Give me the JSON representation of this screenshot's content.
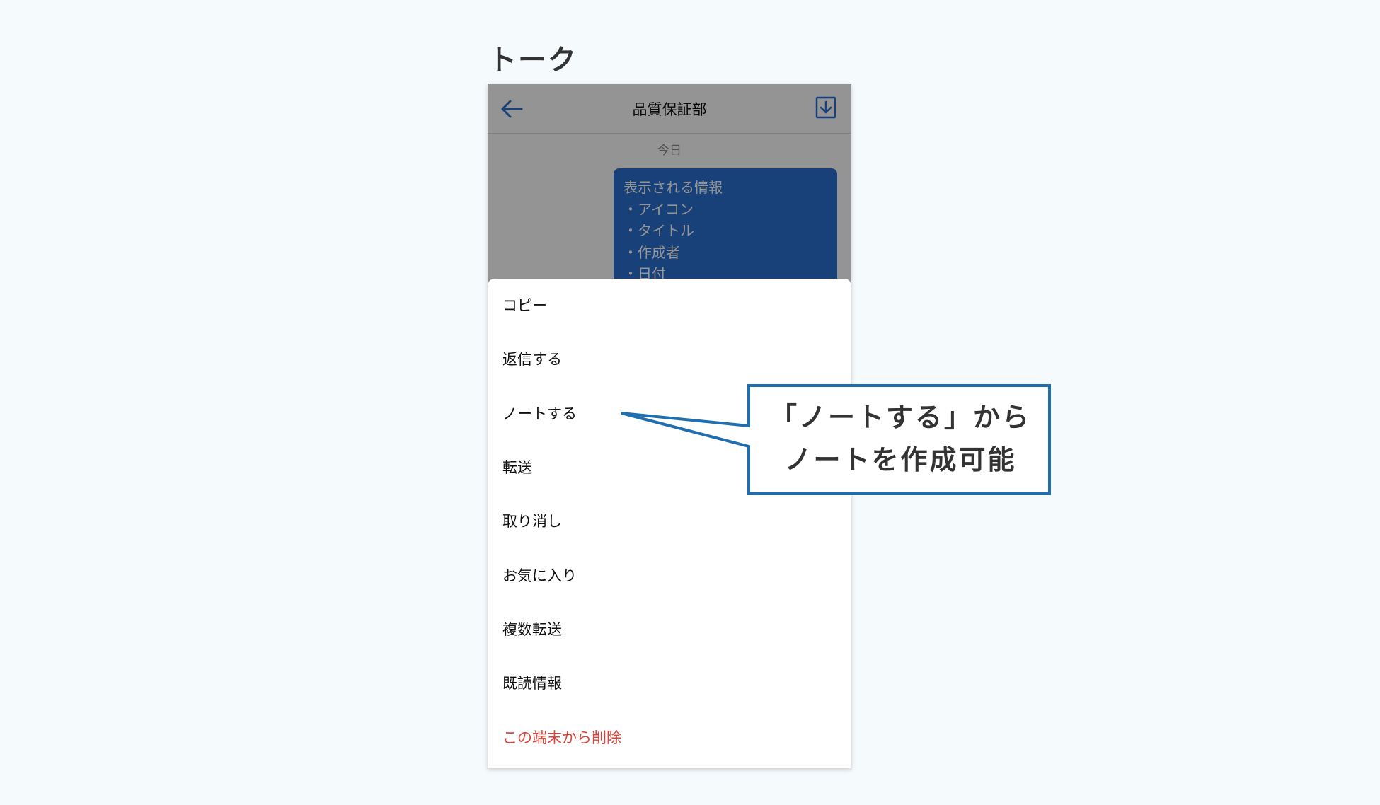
{
  "page": {
    "section_title": "トーク"
  },
  "chat": {
    "title": "品質保証部",
    "date_separator": "今日",
    "bubble_lines": [
      "表示される情報",
      "・アイコン",
      "・タイトル",
      "・作成者",
      "・日付"
    ]
  },
  "menu": {
    "items": [
      {
        "label": "コピー"
      },
      {
        "label": "返信する"
      },
      {
        "label": "ノートする"
      },
      {
        "label": "転送"
      },
      {
        "label": "取り消し"
      },
      {
        "label": "お気に入り"
      },
      {
        "label": "複数転送"
      },
      {
        "label": "既読情報"
      },
      {
        "label": "この端末から削除"
      }
    ]
  },
  "callout": {
    "line1": "「ノートする」から",
    "line2": "ノートを作成可能"
  },
  "colors": {
    "accent": "#2a6fd1",
    "callout_border": "#1f6fb0",
    "danger": "#d9443a",
    "background": "#f5fafd"
  },
  "icons": {
    "back": "arrow-left-icon",
    "download": "download-icon"
  }
}
